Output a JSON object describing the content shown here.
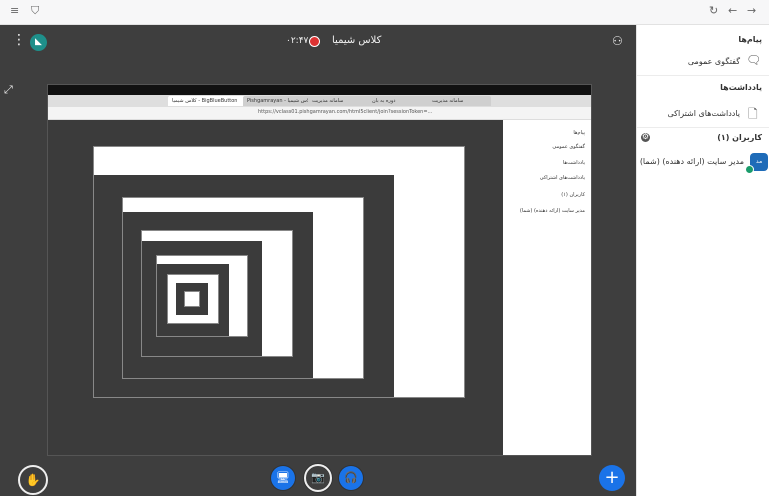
{
  "browser": {
    "menu_icon": "≡",
    "shield_icon": "⛉",
    "reload_icon": "↻",
    "back_icon": "←",
    "forward_icon": "→"
  },
  "topbar": {
    "class_title": "کلاس شیمیا",
    "timer": "۰۲:۴۷",
    "kebab_icon": "⋮",
    "users_icon": "⚇"
  },
  "share": {
    "tabs": [
      "کلاس شیمیا - BigBlueButton",
      "Pishgamrayan - کلاس شیمیا",
      "سامانه مدیریت",
      "دوره به بان",
      "سامانه مدیریت"
    ],
    "url": "https://vclass01.pishgamrayan.com/html5client/join?sessionToken=..."
  },
  "controls": {
    "hand_icon": "✋",
    "screen_icon": "🖥",
    "camera_icon": "📷",
    "audio_icon": "🎧",
    "plus_icon": "+"
  },
  "sidebar": {
    "messages_title": "پیام‌ها",
    "public_chat": "گفتگوی عمومی",
    "notes_title": "یادداشت‌ها",
    "shared_notes": "یادداشت‌های اشتراکی",
    "users_title": "کاربران (۱)",
    "user_name": "مدیر سایت (ارائه دهنده) (شما)",
    "user_initials": "مد"
  },
  "colors": {
    "stage": "#3e3e3e",
    "accent": "#1a73e8",
    "logo": "#1e8f8a"
  }
}
